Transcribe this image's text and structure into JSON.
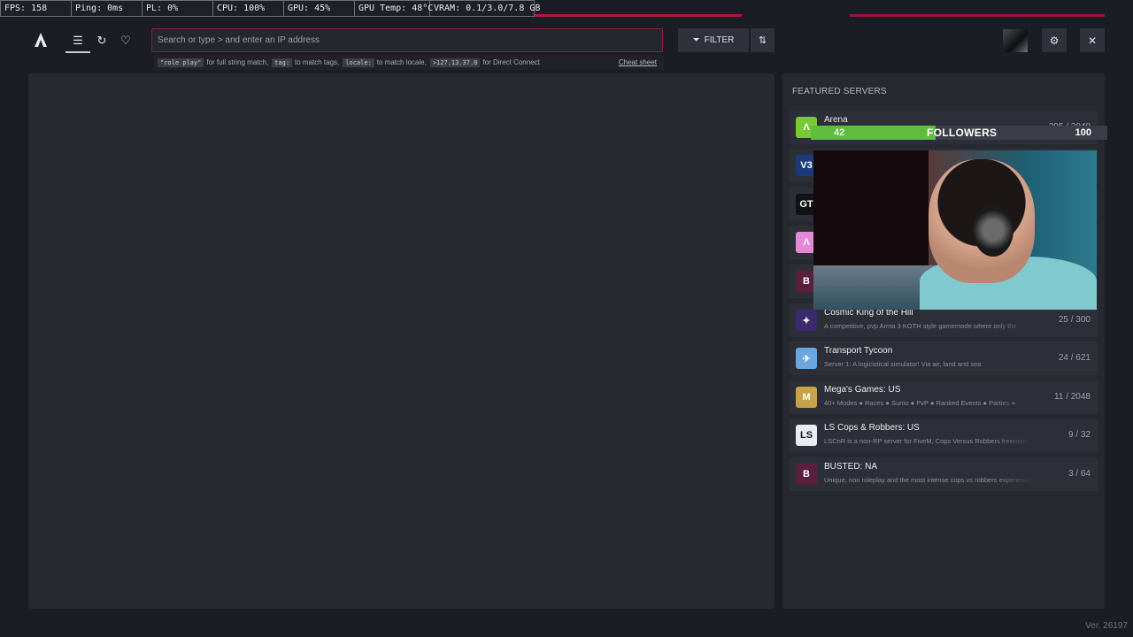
{
  "perf": {
    "fps": "FPS: 158",
    "ping": "Ping: 0ms",
    "pl": "PL: 0%",
    "cpu": "CPU: 100%",
    "gpu": "GPU: 45%",
    "gpu_temp": "GPU Temp: 48°C",
    "vram": "VRAM: 0.1/3.0/7.8 GB"
  },
  "search": {
    "placeholder": "Search or type > and enter an IP address"
  },
  "hints": {
    "h1_code": "\"role play\"",
    "h1_text": "for full string match,",
    "h2_code": "tag:",
    "h2_text": "to match tags,",
    "h3_code": "locale:",
    "h3_text": "to match locale,",
    "h4_code": ">127.13.37.0",
    "h4_text": "for Direct Connect",
    "cheat": "Cheat sheet"
  },
  "toolbar": {
    "filter_label": "FILTER"
  },
  "featured": {
    "title": "FEATURED SERVERS",
    "servers": [
      {
        "name": "Arena",
        "desc": "",
        "count": "295 / 2048",
        "icon_color": "#79c934",
        "icon_glyph": "Λ"
      },
      {
        "name": "",
        "desc": "",
        "count": "",
        "icon_color": "#1d3a7a",
        "icon_glyph": "V3"
      },
      {
        "name": "",
        "desc": "",
        "count": "",
        "icon_color": "#111216",
        "icon_glyph": "GT"
      },
      {
        "name": "",
        "desc": "",
        "count": "",
        "icon_color": "#e38ad6",
        "icon_glyph": "Λ"
      },
      {
        "name": "",
        "desc": "",
        "count": "",
        "icon_color": "#5a1f3d",
        "icon_glyph": "B"
      },
      {
        "name": "Cosmic King of the Hill",
        "desc": "A competitive, pvp Arma 3 KOTH style gamemode where only the",
        "count": "25 / 300",
        "icon_color": "#3b2a6e",
        "icon_glyph": "✦"
      },
      {
        "name": "Transport Tycoon",
        "desc": "Server 1: A logicistical simulator! Via air, land and sea",
        "count": "24 / 621",
        "icon_color": "#6aa6e0",
        "icon_glyph": "✈"
      },
      {
        "name": "Mega's Games: US",
        "desc": "40+ Modes ● Races ● Sumo ● PvP ● Ranked Events ● Parties ●",
        "count": "11 / 2048",
        "icon_color": "#c7a24a",
        "icon_glyph": "M"
      },
      {
        "name": "LS Cops & Robbers: US",
        "desc": "LSCnR is a non-RP server for FiveM, Cops Versus Robbers freeroam",
        "count": "9 / 32",
        "icon_color": "#e9ecf2",
        "icon_glyph": "LS"
      },
      {
        "name": "BUSTED: NA",
        "desc": "Unique, non roleplay and the most intense cops vs robbers experience",
        "count": "3 / 64",
        "icon_color": "#5a1f3d",
        "icon_glyph": "B"
      }
    ]
  },
  "followers": {
    "current": "42",
    "label": "FOLLOWERS",
    "goal": "100",
    "progress": 0.42,
    "fill_color": "#5fbf3c"
  },
  "version": "Ver. 26197"
}
